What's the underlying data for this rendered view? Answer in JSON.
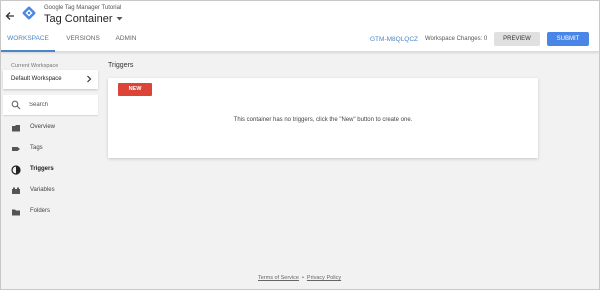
{
  "header": {
    "account_name": "Google Tag Manager Tutorial",
    "container_name": "Tag Container",
    "tabs": [
      {
        "label": "WORKSPACE",
        "active": true
      },
      {
        "label": "VERSIONS",
        "active": false
      },
      {
        "label": "ADMIN",
        "active": false
      }
    ],
    "container_id": "GTM-M8QLQCZ",
    "workspace_changes": "Workspace Changes: 0",
    "preview_label": "PREVIEW",
    "submit_label": "SUBMIT"
  },
  "sidebar": {
    "current_workspace_label": "Current Workspace",
    "workspace_name": "Default Workspace",
    "search_placeholder": "Search",
    "items": [
      {
        "label": "Overview",
        "icon": "overview-icon",
        "active": false
      },
      {
        "label": "Tags",
        "icon": "tag-icon",
        "active": false
      },
      {
        "label": "Triggers",
        "icon": "trigger-icon",
        "active": true
      },
      {
        "label": "Variables",
        "icon": "variables-icon",
        "active": false
      },
      {
        "label": "Folders",
        "icon": "folder-icon",
        "active": false
      }
    ]
  },
  "main": {
    "title": "Triggers",
    "new_button_label": "NEW",
    "empty_message": "This container has no triggers, click the \"New\" button to create one."
  },
  "footer": {
    "terms_label": "Terms of Service",
    "separator": "•",
    "privacy_label": "Privacy Policy"
  },
  "colors": {
    "accent_blue": "#4a86c5",
    "submit_blue": "#4a86e8",
    "new_red": "#db4437",
    "background": "#f2f2f2"
  }
}
